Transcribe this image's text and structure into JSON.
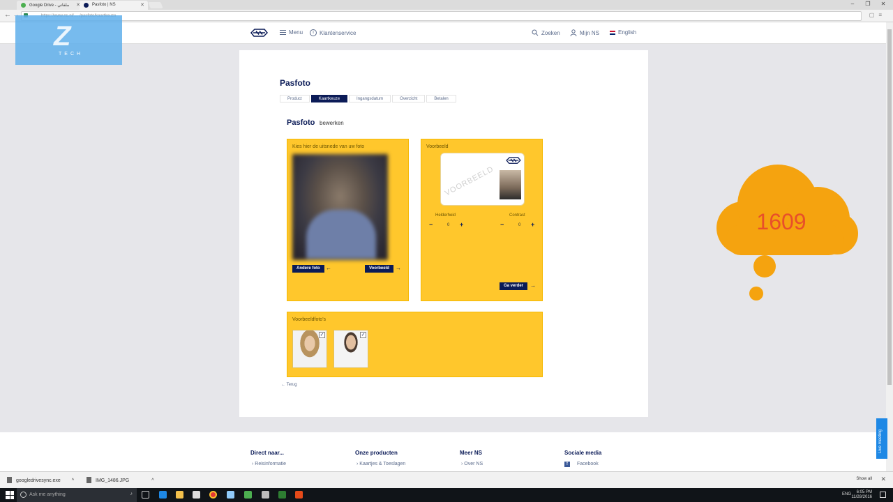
{
  "browser": {
    "tabs": [
      {
        "label": "Google Drive - ملفاتي",
        "active": false
      },
      {
        "label": "Pasfoto | NS",
        "active": true
      }
    ],
    "url": "https://www.ns.nl/...../pasfoto/kaartkeuze",
    "window_controls": [
      "–",
      "❐",
      "✕"
    ]
  },
  "watermark": {
    "letter": "Z",
    "text": "TECH"
  },
  "header": {
    "menu_label": "Menu",
    "service_label": "Klantenservice",
    "search_label": "Zoeken",
    "account_label": "Mijn NS",
    "language_label": "English"
  },
  "page": {
    "title": "Pasfoto",
    "steps": [
      "Product",
      "Kaartkeuze",
      "Ingangsdatum",
      "Overzicht",
      "Betalen"
    ],
    "active_step": "Kaartkeuze",
    "section_title": "Pasfoto",
    "section_sub": "bewerken",
    "crop_panel": {
      "label": "Kies hier de uitsnede van uw foto",
      "other_photo_button": "Andere foto",
      "preview_button": "Voorbeeld"
    },
    "preview_panel": {
      "label": "Voorbeeld",
      "stamp": "VOORBEELD",
      "brightness_label": "Helderheid",
      "brightness_value": "0",
      "contrast_label": "Contrast",
      "contrast_value": "0",
      "continue_button": "Ga verder"
    },
    "examples_panel": {
      "label": "Voorbeeldfoto's",
      "check_glyph": "✓"
    },
    "back_link": "Terug"
  },
  "overlay": {
    "number": "1609",
    "colors": {
      "cloud": "#f5a30f",
      "number": "#e84f2a"
    }
  },
  "footer": {
    "columns": [
      {
        "title": "Direct naar...",
        "link": "Reisinformatie"
      },
      {
        "title": "Onze producten",
        "link": "Kaartjes & Toeslagen"
      },
      {
        "title": "Meer NS",
        "link": "Over NS"
      },
      {
        "title": "Sociale media",
        "link": "Facebook"
      }
    ],
    "live_tab": "Live meeting"
  },
  "downloads": {
    "items": [
      "googledrivesync.exe",
      "IMG_1486.JPG"
    ],
    "show_all": "Show all"
  },
  "taskbar": {
    "search_placeholder": "Ask me anything",
    "language": "ENG",
    "time": "6:05 PM",
    "date": "11/28/2016"
  },
  "colors": {
    "brand_navy": "#0b1b57",
    "brand_yellow": "#ffc72c"
  }
}
